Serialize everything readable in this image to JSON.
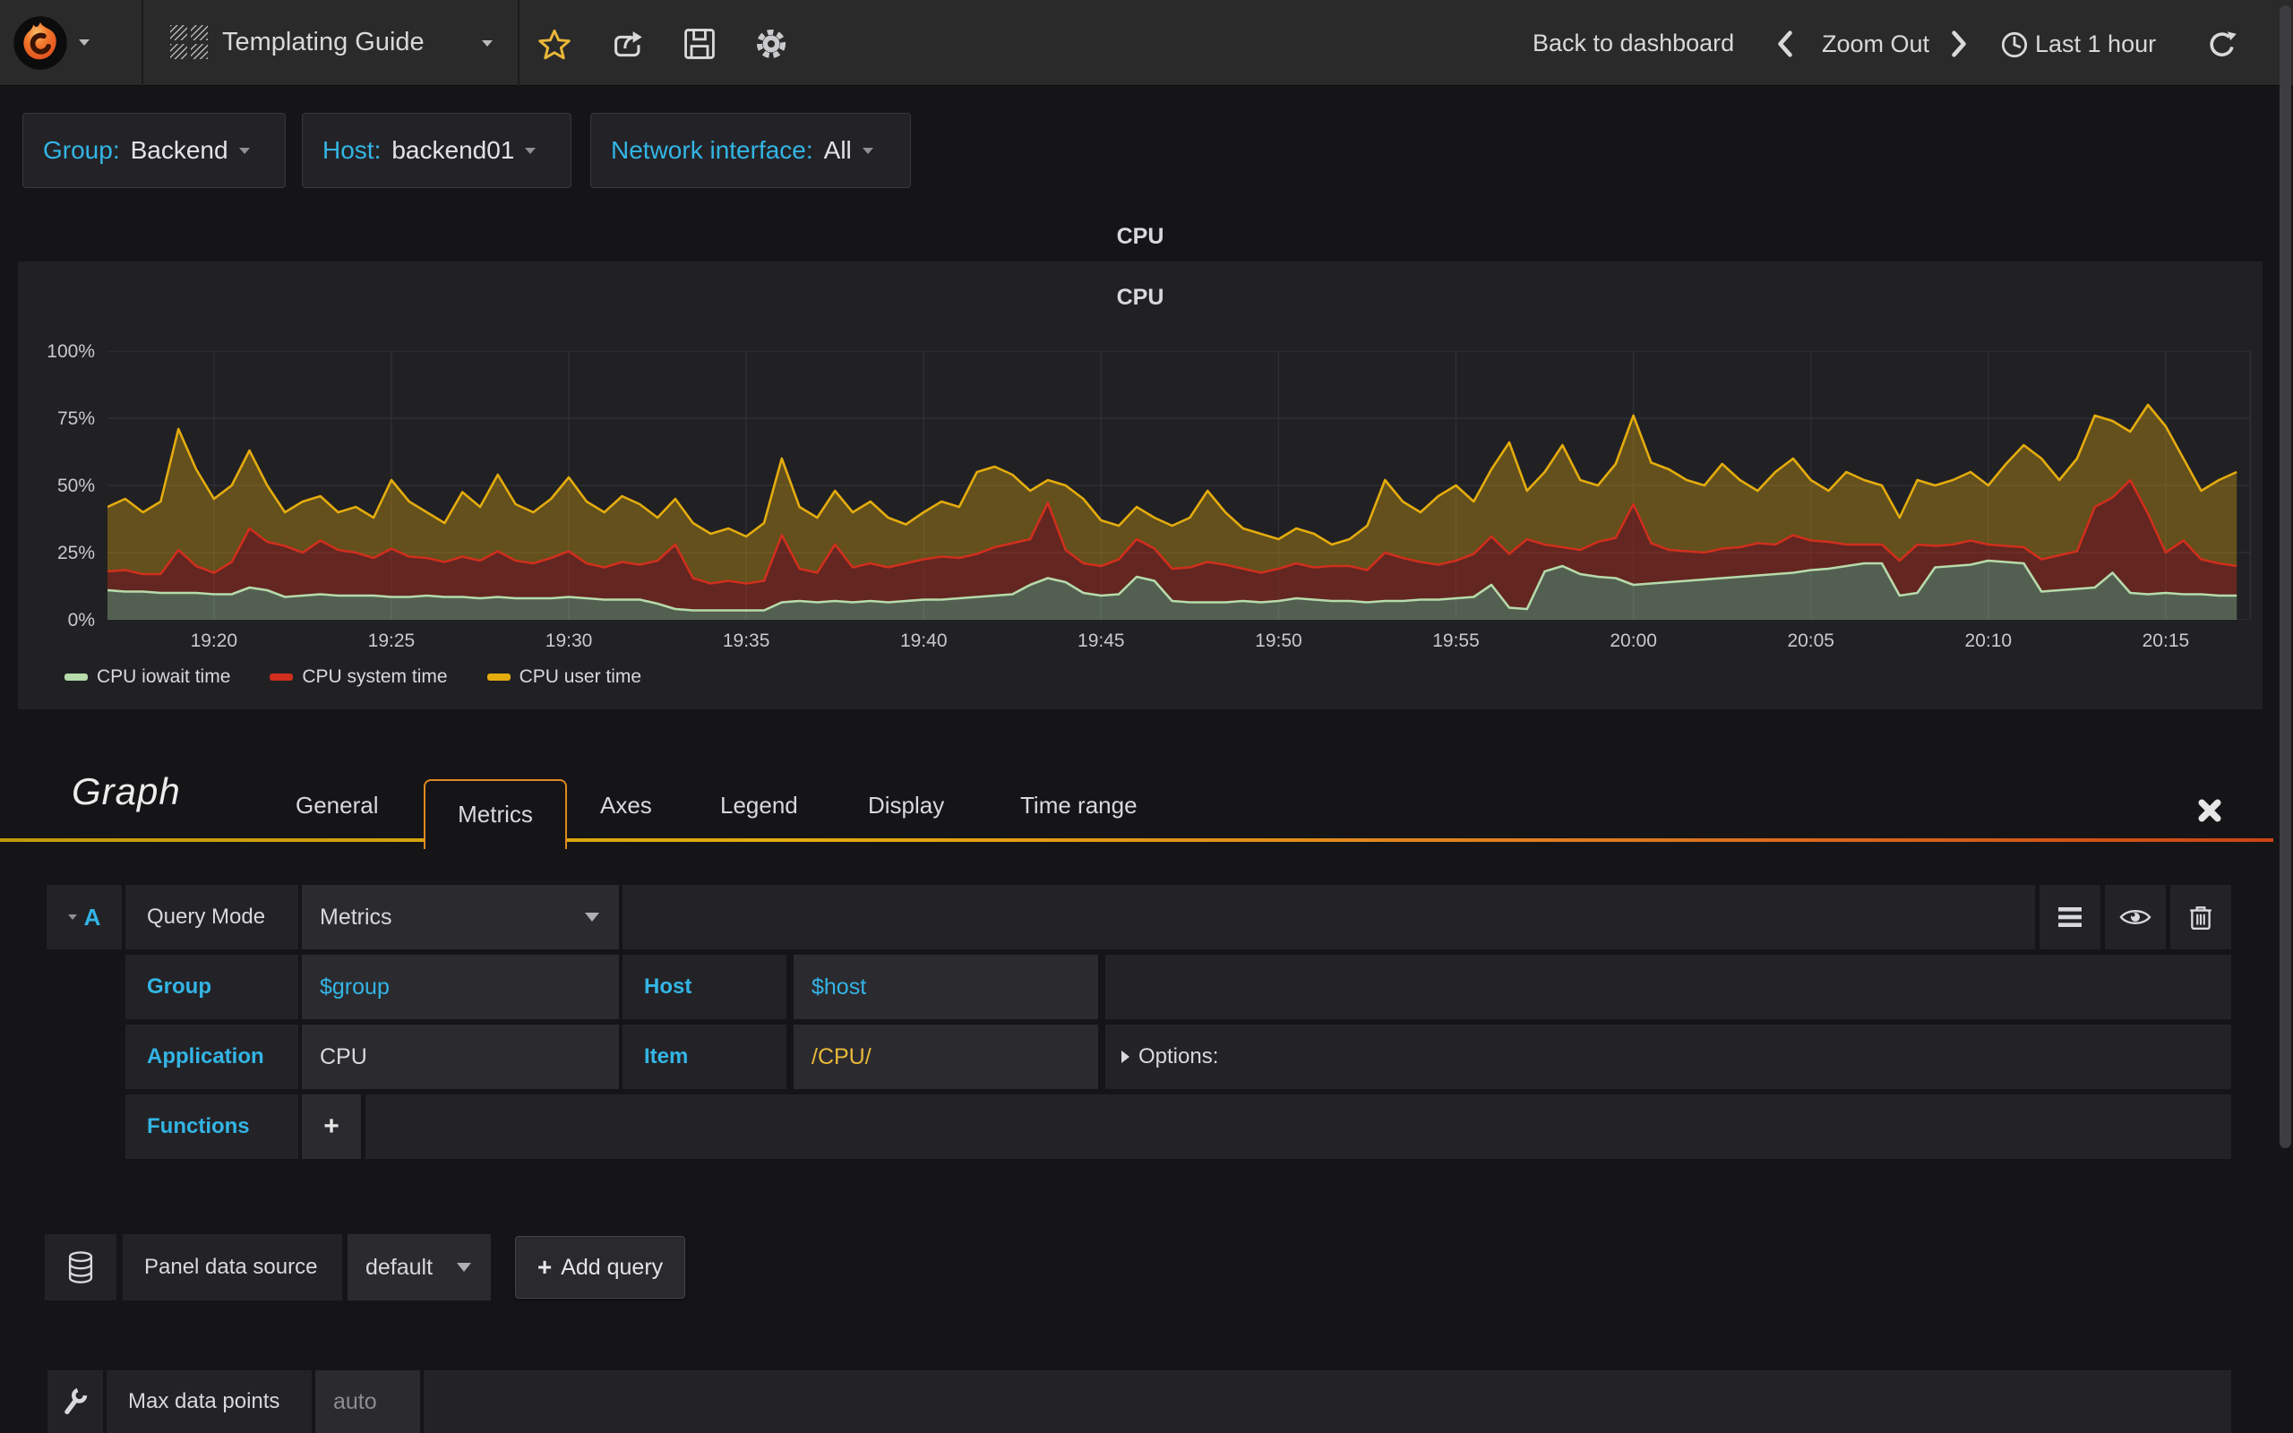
{
  "accent_blue": "#33b5e5",
  "accent_orange": "#e08821",
  "navbar": {
    "dashboard_title": "Templating Guide",
    "back_to_dashboard": "Back to dashboard",
    "zoom_out": "Zoom Out",
    "time_range": "Last 1 hour"
  },
  "variables": [
    {
      "label": "Group:",
      "value": "Backend"
    },
    {
      "label": "Host:",
      "value": "backend01"
    },
    {
      "label": "Network interface:",
      "value": "All"
    }
  ],
  "panel": {
    "header_title": "CPU"
  },
  "chart_data": {
    "type": "area",
    "stacked": true,
    "title": "CPU",
    "x_start": "19:17",
    "x_step_seconds": 30,
    "x_domain_minutes": 60.4,
    "ylim": [
      0,
      100
    ],
    "grid": true,
    "legend_position": "bottom-left",
    "x_tick_labels": [
      "19:20",
      "19:25",
      "19:30",
      "19:35",
      "19:40",
      "19:45",
      "19:50",
      "19:55",
      "20:00",
      "20:05",
      "20:10",
      "20:15"
    ],
    "x_tick_minutes": [
      3,
      8,
      13,
      18,
      23,
      28,
      33,
      38,
      43,
      48,
      53,
      58
    ],
    "y_tick_labels": [
      "0%",
      "25%",
      "50%",
      "75%",
      "100%"
    ],
    "y_tick_values": [
      0,
      25,
      50,
      75,
      100
    ],
    "series": [
      {
        "name": "CPU iowait time",
        "color": "#b7dbab",
        "fill_opacity": 0.34,
        "values": [
          11,
          10.5,
          10.5,
          10,
          10,
          10,
          9.5,
          9.5,
          12,
          11,
          8.5,
          9,
          9.5,
          9,
          9,
          9,
          8.5,
          8.5,
          9,
          8.5,
          8.5,
          8,
          8.5,
          8,
          8,
          8,
          8.5,
          8,
          7.5,
          7.5,
          7.5,
          6,
          4,
          3.5,
          3.5,
          3.5,
          3.5,
          3.5,
          6.5,
          7,
          6.5,
          7,
          6.5,
          7,
          6.5,
          7,
          7.5,
          7.5,
          8,
          8.5,
          9,
          9.5,
          13,
          15.5,
          14,
          10,
          9,
          9.5,
          16,
          14.5,
          7,
          6.5,
          6.5,
          6.5,
          7,
          6.5,
          7,
          8,
          7.5,
          7,
          7,
          6.5,
          7,
          7,
          7.5,
          7.5,
          8,
          8.5,
          13,
          4.5,
          4,
          18,
          20,
          17,
          16,
          15.5,
          13,
          13.5,
          14,
          14.5,
          15,
          15.5,
          16,
          16.5,
          17,
          17.5,
          18.5,
          19,
          20,
          21,
          21,
          9,
          10,
          19.5,
          20,
          20.5,
          22,
          21.5,
          21,
          10.5,
          11,
          11.5,
          12,
          17.5,
          10,
          9.5,
          10,
          9.5,
          9.5,
          9,
          9
        ]
      },
      {
        "name": "CPU system time",
        "color": "#cf2f1c",
        "fill_opacity": 0.38,
        "values": [
          7,
          8,
          6.5,
          7,
          16,
          10,
          8,
          12,
          22,
          18,
          19,
          16,
          20,
          17,
          16,
          14,
          18,
          15,
          14,
          13,
          15,
          14,
          17,
          14,
          13,
          15,
          17,
          13,
          12,
          14,
          13,
          16,
          24,
          12,
          10,
          11,
          10,
          11,
          25,
          12,
          11,
          21,
          13,
          14,
          13,
          14,
          15,
          16,
          15,
          16,
          18,
          19,
          17,
          28,
          12,
          11,
          11,
          13,
          14,
          12,
          12,
          13,
          15,
          14,
          12,
          11,
          12,
          13,
          12,
          13,
          13,
          12,
          18,
          16,
          14,
          13,
          14,
          16,
          18,
          20,
          26,
          10,
          7,
          9,
          13,
          15,
          30,
          15,
          12,
          11,
          10,
          11,
          11,
          12,
          11,
          14,
          11,
          10,
          8,
          7,
          7,
          13,
          18,
          8,
          8,
          9,
          6,
          6,
          6,
          12,
          13,
          14,
          30,
          28,
          42,
          30,
          15,
          20,
          13,
          12,
          11
        ]
      },
      {
        "name": "CPU user time",
        "color": "#e5ac0e",
        "fill_opacity": 0.34,
        "values": [
          24,
          26.5,
          23,
          27,
          45,
          36,
          27.5,
          28.5,
          29,
          21,
          12.5,
          19,
          16.5,
          14,
          17,
          15,
          25.5,
          20.5,
          17,
          14.5,
          24,
          20,
          28.5,
          21,
          19,
          22,
          27.5,
          23,
          20.5,
          24.5,
          22.5,
          16,
          17,
          20.5,
          18.5,
          19.5,
          17.5,
          21.5,
          28.5,
          23,
          20.5,
          20,
          20.5,
          23,
          18.5,
          14.5,
          17.5,
          20.5,
          19,
          30.5,
          30,
          25.5,
          18,
          8.5,
          24,
          24,
          17,
          12.5,
          12,
          11.5,
          16,
          18.5,
          26.5,
          19.5,
          15,
          14.5,
          11,
          13,
          12.5,
          8,
          10,
          16.5,
          27,
          21,
          18.5,
          25.5,
          28,
          19.5,
          25,
          41.5,
          18,
          27,
          38,
          26,
          21,
          27.5,
          33,
          30,
          30,
          26.5,
          25,
          31.5,
          25,
          19.5,
          27,
          28.5,
          22.5,
          19,
          27,
          24,
          22,
          16,
          24,
          22.5,
          24,
          25.5,
          22,
          30.5,
          38,
          37.5,
          28,
          34.5,
          34,
          28.5,
          18,
          40.5,
          47,
          30.5,
          25.5,
          31,
          35
        ]
      }
    ]
  },
  "editor": {
    "panel_type": "Graph",
    "tabs": [
      "General",
      "Metrics",
      "Axes",
      "Legend",
      "Display",
      "Time range"
    ],
    "active_tab_index": 1
  },
  "query": {
    "ref": "A",
    "query_mode_label": "Query Mode",
    "query_mode_value": "Metrics",
    "group_label": "Group",
    "group_value": "$group",
    "host_label": "Host",
    "host_value": "$host",
    "app_label": "Application",
    "app_value": "CPU",
    "item_label": "Item",
    "item_value": "/CPU/",
    "options_label": "Options:",
    "functions_label": "Functions",
    "add_function_label": "+"
  },
  "datasource": {
    "label": "Panel data source",
    "value": "default",
    "add_query_plus": "+",
    "add_query_label": "Add query"
  },
  "settings": {
    "max_data_points_label": "Max data points",
    "max_data_points_placeholder": "auto"
  }
}
